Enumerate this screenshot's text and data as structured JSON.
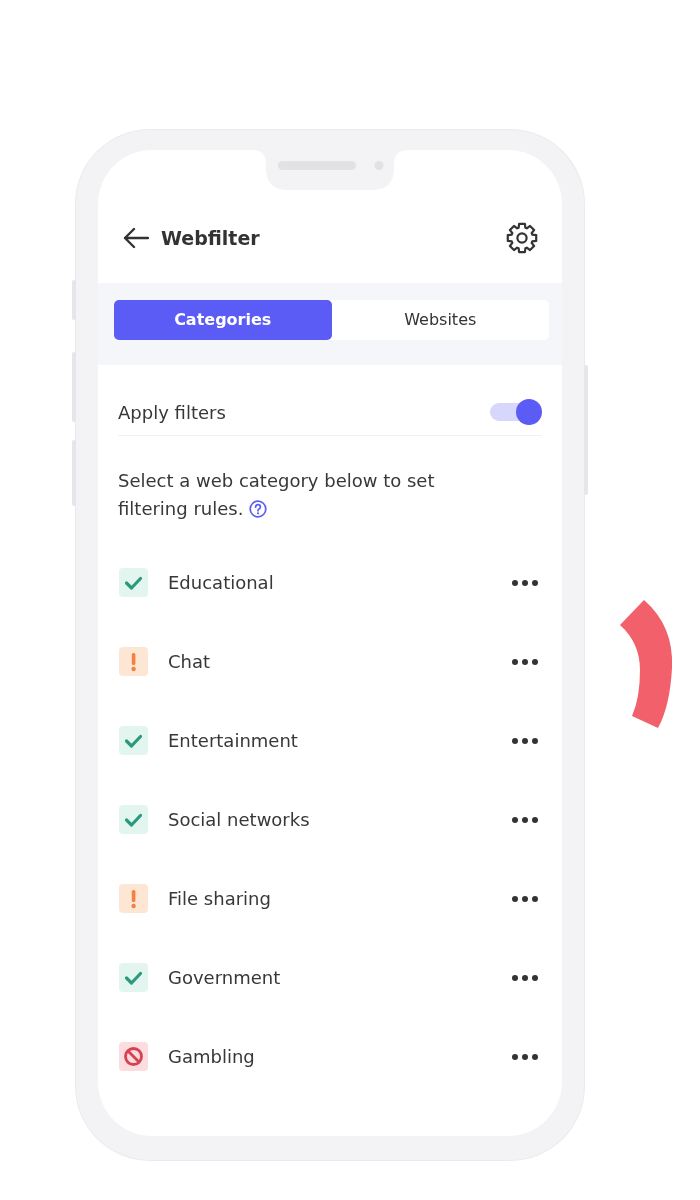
{
  "header": {
    "title": "Webfilter"
  },
  "tabs": [
    {
      "label": "Categories",
      "selected": true
    },
    {
      "label": "Websites",
      "selected": false
    }
  ],
  "apply_filters": {
    "label": "Apply filters",
    "on": true
  },
  "description": "Select a web category below to set filtering rules.",
  "categories": [
    {
      "name": "Educational",
      "kind": "allowed"
    },
    {
      "name": "Chat",
      "kind": "warning"
    },
    {
      "name": "Entertainment",
      "kind": "allowed"
    },
    {
      "name": "Social networks",
      "kind": "allowed"
    },
    {
      "name": "File sharing",
      "kind": "warning"
    },
    {
      "name": "Government",
      "kind": "allowed"
    },
    {
      "name": "Gambling",
      "kind": "blocked"
    }
  ]
}
